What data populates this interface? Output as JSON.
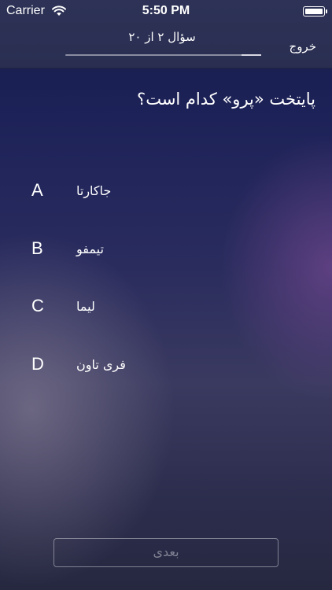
{
  "status_bar": {
    "carrier": "Carrier",
    "time": "5:50 PM"
  },
  "header": {
    "question_counter": "سؤال ۲ از ۲۰",
    "exit_label": "خروج",
    "progress": 0.1
  },
  "question": {
    "text": "پایتخت «پرو» کدام است؟"
  },
  "options": [
    {
      "letter": "A",
      "text": "جاکارتا"
    },
    {
      "letter": "B",
      "text": "تیمفو"
    },
    {
      "letter": "C",
      "text": "لیما"
    },
    {
      "letter": "D",
      "text": "فری تاون"
    }
  ],
  "footer": {
    "next_label": "بعدی"
  }
}
